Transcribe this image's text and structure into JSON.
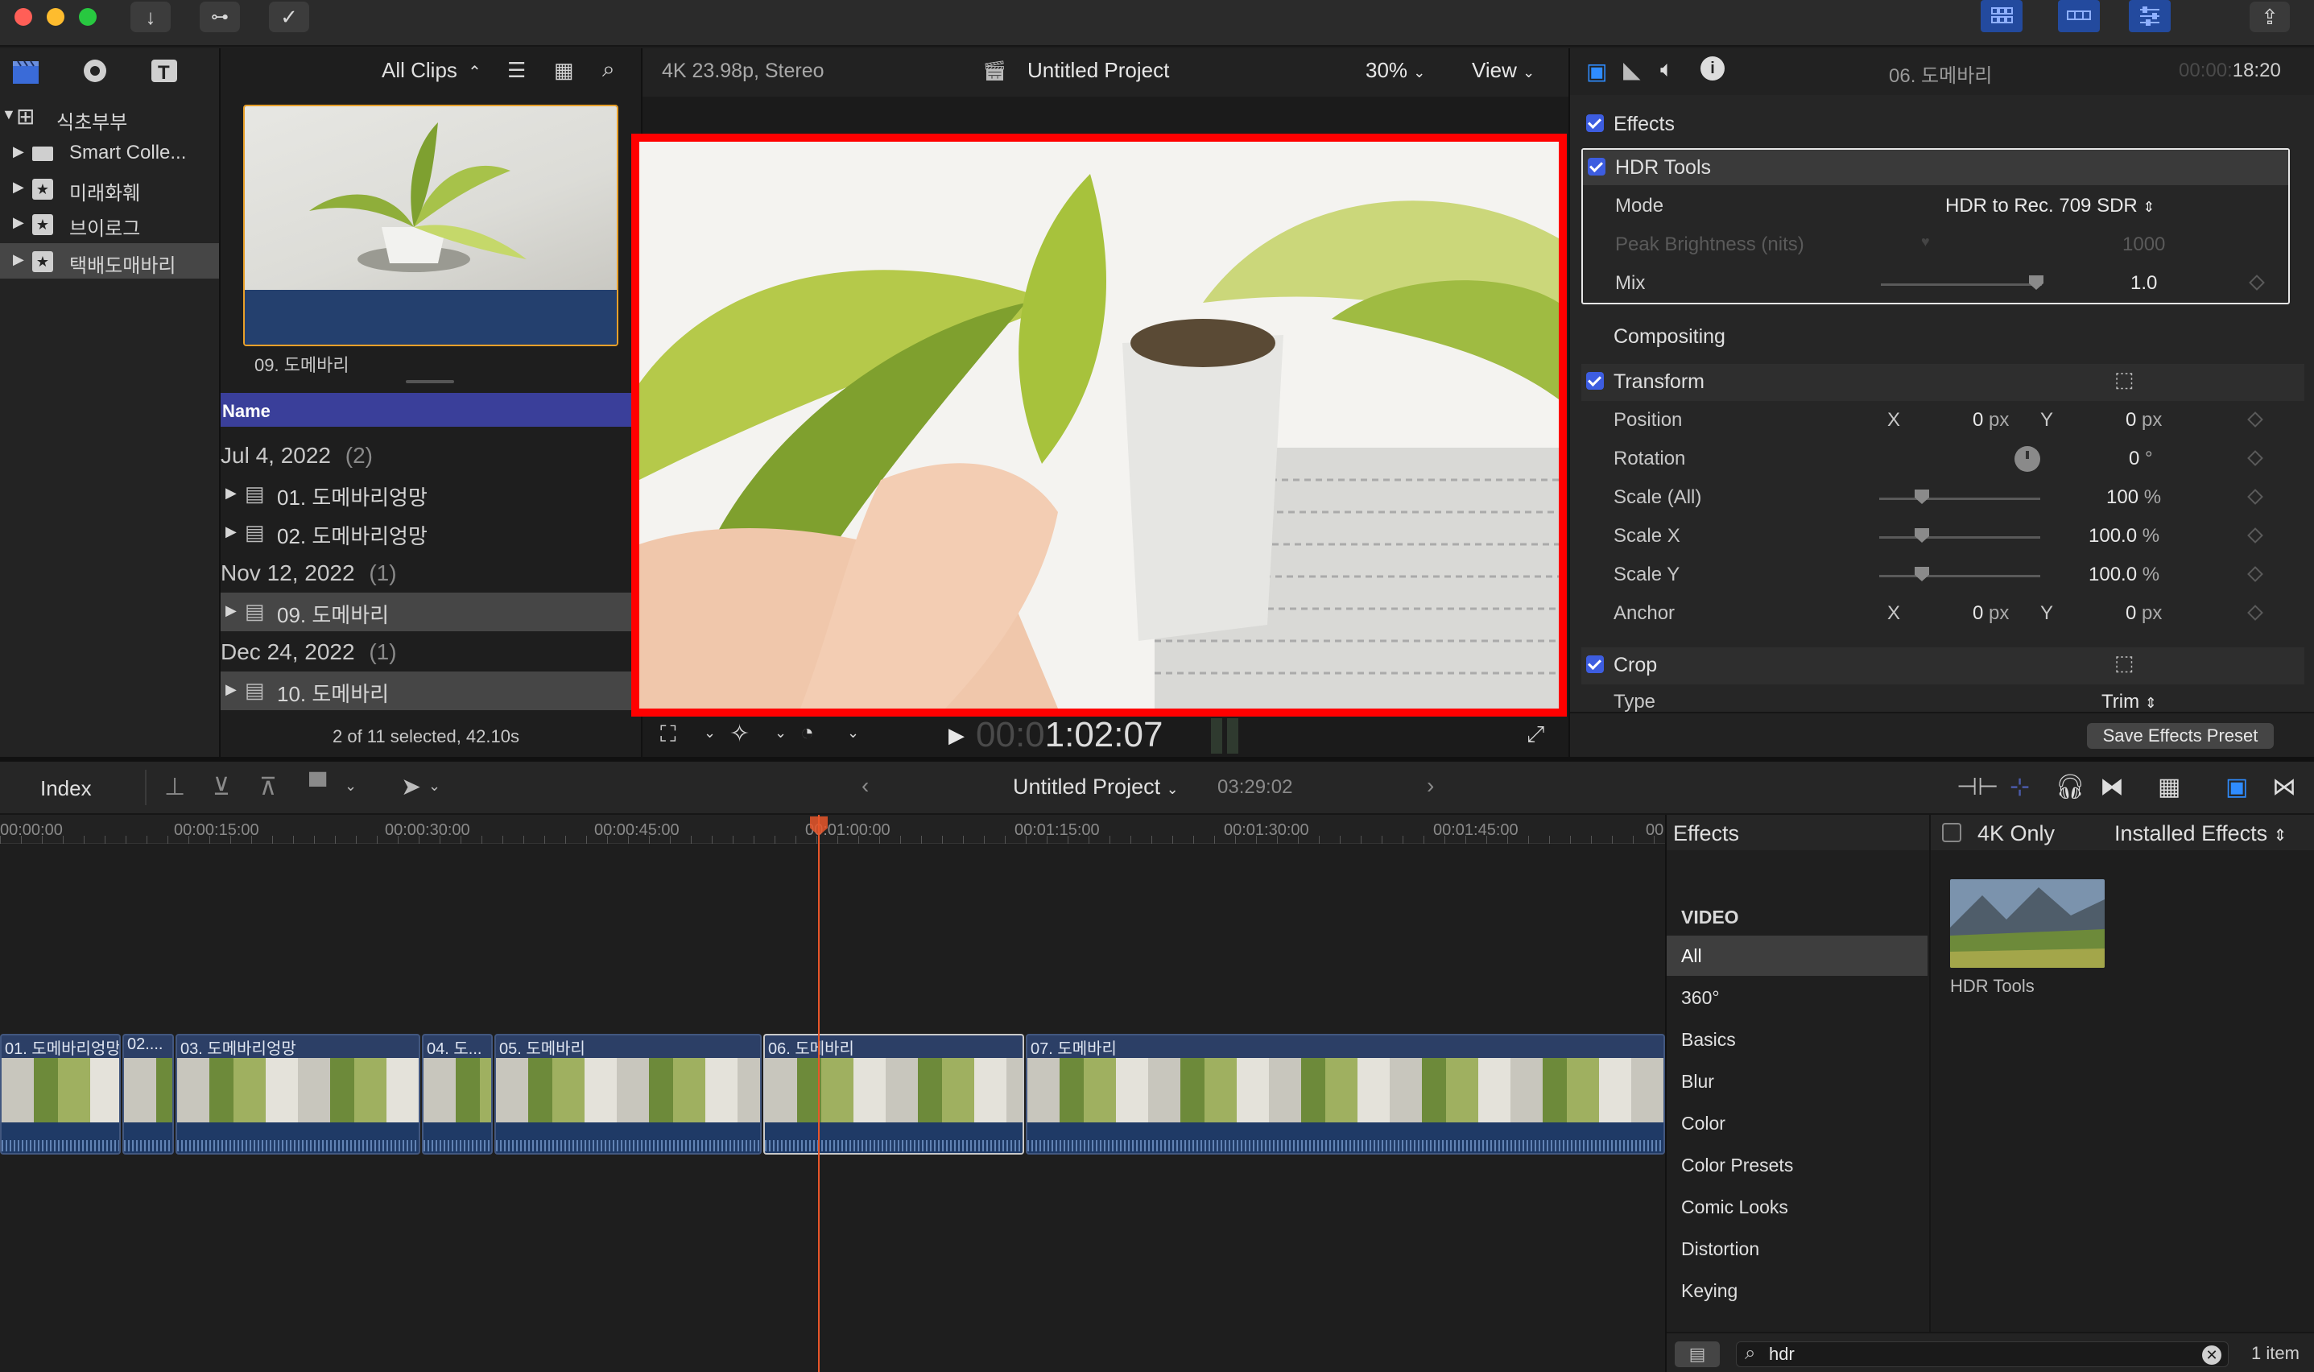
{
  "toolbar": {
    "left_icons": [
      "import-icon",
      "keywords-icon",
      "background-tasks-icon"
    ],
    "right_icons": [
      "browser-layout-icon",
      "timeline-layout-icon",
      "inspector-layout-icon",
      "share-icon"
    ]
  },
  "library": {
    "items": [
      {
        "label": "식초부부",
        "icon": "library-icon",
        "expanded": true
      },
      {
        "label": "Smart Colle...",
        "icon": "folder-icon"
      },
      {
        "label": "미래화훼",
        "icon": "event-icon"
      },
      {
        "label": "브이로그",
        "icon": "event-icon"
      },
      {
        "label": "택배도매바리",
        "icon": "event-icon",
        "selected": true
      }
    ]
  },
  "browser": {
    "filter": "All Clips",
    "thumb_caption": "09. 도메바리",
    "column_header": "Name",
    "groups": [
      {
        "date": "Jul 4, 2022",
        "count": "(2)",
        "clips": [
          "01. 도메바리엉망",
          "02. 도메바리엉망"
        ]
      },
      {
        "date": "Nov 12, 2022",
        "count": "(1)",
        "clips": [
          "09. 도메바리"
        ]
      },
      {
        "date": "Dec 24, 2022",
        "count": "(1)",
        "clips": [
          "10. 도메바리"
        ]
      }
    ],
    "status": "2 of 11 selected, 42.10s"
  },
  "viewer": {
    "format": "4K 23.98p, Stereo",
    "project": "Untitled Project",
    "zoom": "30%",
    "view_label": "View",
    "timecode_dim": "00:0",
    "timecode": "1:02:07"
  },
  "inspector": {
    "clip_name": "06. 도메바리",
    "duration_dim": "00:00:",
    "duration": "18:20",
    "effects_label": "Effects",
    "hdr": {
      "title": "HDR Tools",
      "mode_label": "Mode",
      "mode_value": "HDR to Rec. 709 SDR",
      "peak_label": "Peak Brightness (nits)",
      "peak_value": "1000",
      "mix_label": "Mix",
      "mix_value": "1.0"
    },
    "compositing_label": "Compositing",
    "transform_label": "Transform",
    "position_label": "Position",
    "x_label": "X",
    "y_label": "Y",
    "position_x": "0",
    "position_y": "0",
    "px_unit": "px",
    "rotation_label": "Rotation",
    "rotation_value": "0",
    "degree_unit": "°",
    "scale_all_label": "Scale (All)",
    "scale_all_value": "100",
    "scale_x_label": "Scale X",
    "scale_x_value": "100.0",
    "scale_y_label": "Scale Y",
    "scale_y_value": "100.0",
    "percent_unit": "%",
    "anchor_label": "Anchor",
    "anchor_x": "0",
    "anchor_y": "0",
    "crop_label": "Crop",
    "type_label": "Type",
    "type_value": "Trim",
    "save_preset": "Save Effects Preset"
  },
  "timeline": {
    "index_label": "Index",
    "project": "Untitled Project",
    "duration": "03:29:02",
    "ruler": [
      "00:00:00",
      "00:00:15:00",
      "00:00:30:00",
      "00:00:45:00",
      "00:01:00:00",
      "00:01:15:00",
      "00:01:30:00",
      "00:01:45:00",
      "00"
    ],
    "clips": [
      "01. 도메바리엉망",
      "02....",
      "03. 도메바리엉망",
      "04. 도...",
      "05. 도메바리",
      "06. 도메바리",
      "07. 도메바리"
    ]
  },
  "effects_browser": {
    "title": "Effects",
    "four_k_only": "4K Only",
    "installed": "Installed Effects",
    "section": "VIDEO",
    "categories": [
      "All",
      "360°",
      "Basics",
      "Blur",
      "Color",
      "Color Presets",
      "Comic Looks",
      "Distortion",
      "Keying"
    ],
    "result_name": "HDR Tools",
    "search_value": "hdr",
    "item_count": "1 item"
  },
  "colors": {
    "accent": "#3d5de0",
    "highlight_border": "#ff0000",
    "playhead": "#e8562a",
    "selected_row": "#2f3fa0"
  }
}
